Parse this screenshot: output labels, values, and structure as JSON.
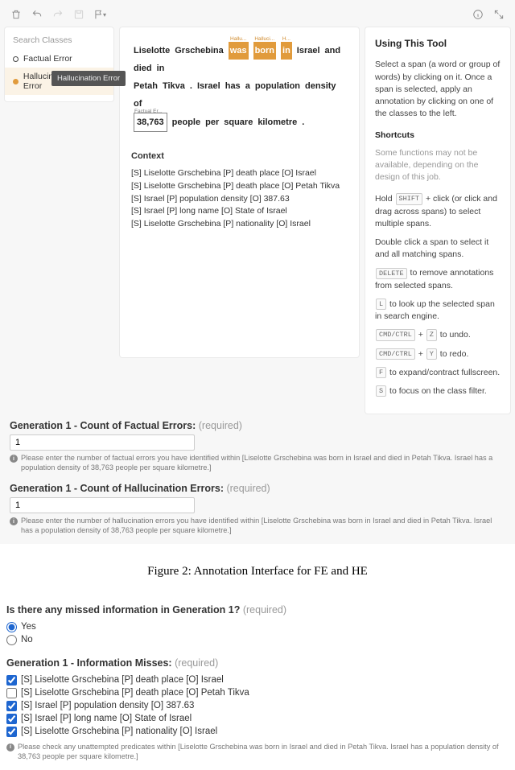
{
  "toolbar": {
    "icons": [
      "trash",
      "undo",
      "redo",
      "save",
      "flag",
      "info",
      "expand"
    ]
  },
  "sidebar": {
    "title": "Search Classes",
    "items": [
      {
        "label": "Factual Error",
        "selected": false
      },
      {
        "label": "Hallucination Error",
        "selected": true
      }
    ],
    "tooltip": "Hallucination Error"
  },
  "main": {
    "tokens_line1": [
      "Liselotte",
      "Grschebina"
    ],
    "tokens_hl": [
      {
        "t": "was",
        "lab": "Hallu..."
      },
      {
        "t": "born",
        "lab": "Halluci..."
      },
      {
        "t": "in",
        "lab": "H..."
      }
    ],
    "tokens_line1b": [
      "Israel",
      "and",
      "died",
      "in"
    ],
    "tokens_line2a": [
      "Petah",
      "Tikva",
      ".",
      "Israel",
      "has",
      "a",
      "population",
      "density",
      "of"
    ],
    "fe_value": "38,763",
    "fe_label": "Factual Er...",
    "tokens_line3": [
      "people",
      "per",
      "square",
      "kilometre",
      "."
    ],
    "context_title": "Context",
    "context": [
      "[S] Liselotte Grschebina [P] death place [O] Israel",
      "[S] Liselotte Grschebina [P] death place [O] Petah Tikva",
      "[S] Israel [P] population density [O] 387.63",
      "[S] Israel [P] long name [O] State of Israel",
      "[S] Liselotte Grschebina [P] nationality [O] Israel"
    ]
  },
  "right": {
    "title": "Using This Tool",
    "intro": "Select a span (a word or group of words) by clicking on it. Once a span is selected, apply an annotation by clicking on one of the classes to the left.",
    "shortcuts_title": "Shortcuts",
    "shortcuts_note": "Some functions may not be available, depending on the design of this job.",
    "hold": "Hold",
    "hold_key": "SHIFT",
    "hold_rest": " + click (or click and drag across spans) to select multiple spans.",
    "dbl": "Double click a span to select it and all matching spans.",
    "lines": [
      {
        "keys": [
          "DELETE"
        ],
        "text": " to remove annotations from selected spans."
      },
      {
        "keys": [
          "L"
        ],
        "text": " to look up the selected span in search engine."
      },
      {
        "keys": [
          "CMD/CTRL",
          "+",
          "Z"
        ],
        "text": " to undo."
      },
      {
        "keys": [
          "CMD/CTRL",
          "+",
          "Y"
        ],
        "text": " to redo."
      },
      {
        "keys": [
          "F"
        ],
        "text": " to expand/contract fullscreen."
      },
      {
        "keys": [
          "S"
        ],
        "text": " to focus on the class filter."
      }
    ]
  },
  "form1": {
    "label": "Generation 1 - Count of Factual Errors:",
    "req": "(required)",
    "value": "1",
    "hint": "Please enter the number of factual errors you have identified within [Liselotte Grschebina was born in Israel and died in Petah Tikva. Israel has a population density of 38,763 people per square kilometre.]"
  },
  "form2": {
    "label": "Generation 1 - Count of Hallucination Errors:",
    "req": "(required)",
    "value": "1",
    "hint": "Please enter the number of hallucination errors you have identified within [Liselotte Grschebina was born in Israel and died in Petah Tikva. Israel has a population density of 38,763 people per square kilometre.]"
  },
  "caption": "Figure 2: Annotation Interface for FE and HE",
  "q_missed": {
    "label": "Is there any missed information in Generation 1?",
    "req": "(required)",
    "options": [
      {
        "label": "Yes",
        "checked": true
      },
      {
        "label": "No",
        "checked": false
      }
    ]
  },
  "q_misses": {
    "label": "Generation 1 - Information Misses:",
    "req": "(required)",
    "options": [
      {
        "label": "[S] Liselotte Grschebina [P] death place [O] Israel",
        "checked": true
      },
      {
        "label": "[S] Liselotte Grschebina [P] death place [O] Petah Tikva",
        "checked": false
      },
      {
        "label": "[S] Israel [P] population density [O] 387.63",
        "checked": true
      },
      {
        "label": "[S] Israel [P] long name [O] State of Israel",
        "checked": true
      },
      {
        "label": "[S] Liselotte Grschebina [P] nationality [O] Israel",
        "checked": true
      }
    ],
    "hint": "Please check any unattempted predicates within [Liselotte Grschebina was born in Israel and died in Petah Tikva. Israel has a population density of 38,763 people per square kilometre.]"
  }
}
